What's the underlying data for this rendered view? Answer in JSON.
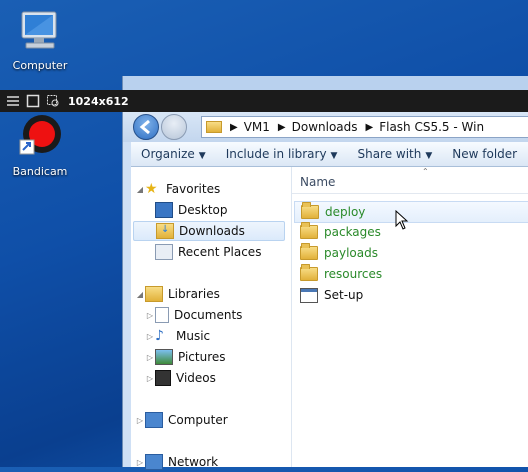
{
  "desktop": {
    "icons": [
      {
        "label": "Computer",
        "icon": "computer-icon"
      },
      {
        "label": "Bandicam",
        "icon": "bandicam-icon"
      }
    ]
  },
  "recorder": {
    "size_readout": "1024x612"
  },
  "explorer": {
    "breadcrumb": [
      "VM1",
      "Downloads",
      "Flash CS5.5 - Win"
    ],
    "commands": [
      {
        "label": "Organize"
      },
      {
        "label": "Include in library"
      },
      {
        "label": "Share with"
      },
      {
        "label": "New folder"
      }
    ],
    "nav": {
      "favorites": {
        "label": "Favorites",
        "items": [
          "Desktop",
          "Downloads",
          "Recent Places"
        ],
        "selected": "Downloads"
      },
      "libraries": {
        "label": "Libraries",
        "items": [
          "Documents",
          "Music",
          "Pictures",
          "Videos"
        ]
      },
      "computer": "Computer",
      "network": "Network"
    },
    "columns": {
      "name": "Name"
    },
    "files": [
      {
        "name": "deploy",
        "type": "folder"
      },
      {
        "name": "packages",
        "type": "folder"
      },
      {
        "name": "payloads",
        "type": "folder"
      },
      {
        "name": "resources",
        "type": "folder"
      },
      {
        "name": "Set-up",
        "type": "application"
      }
    ],
    "colors": {
      "folder_text": "#2a8a2a",
      "accent": "#1e395b"
    }
  }
}
